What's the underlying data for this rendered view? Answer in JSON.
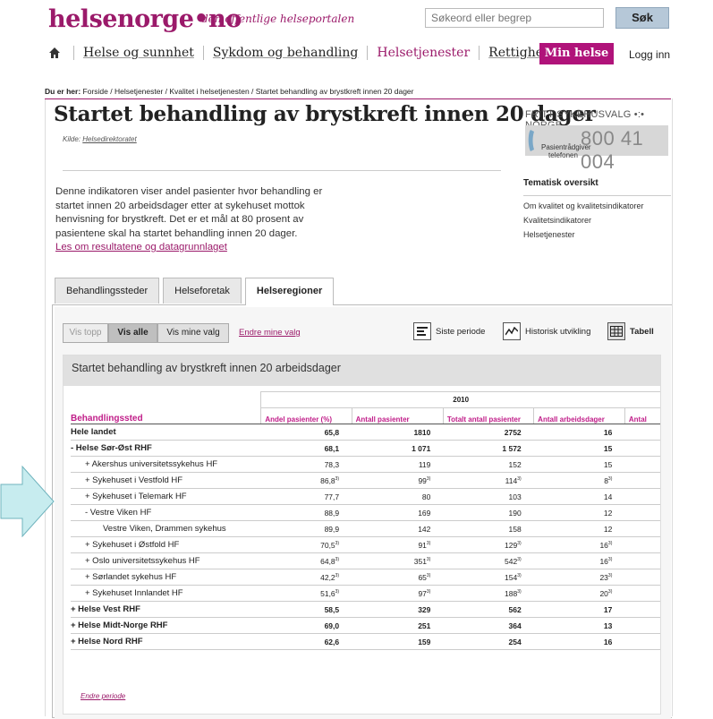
{
  "header": {
    "logo_text": "helsenorge",
    "logo_dot": "•",
    "logo_suffix": "no",
    "tagline": "den offentlige helseportalen",
    "search_placeholder": "Søkeord eller begrep",
    "search_button": "Søk"
  },
  "nav": {
    "items": [
      {
        "label": "Helse og sunnhet"
      },
      {
        "label": "Sykdom og behandling"
      },
      {
        "label": "Helsetjenester"
      },
      {
        "label": "Rettigheter"
      }
    ],
    "min_helse": "Min helse",
    "login": "Logg inn"
  },
  "breadcrumb": {
    "prefix": "Du er her:",
    "path": "Forside / Helsetjenester / Kvalitet i helsetjenesten / Startet behandling av brystkreft innen 20 dager"
  },
  "page": {
    "title": "Startet behandling av brystkreft innen 20 dager",
    "source_label": "Kilde:",
    "source_link": "Helsedirektoratet",
    "intro": "Denne indikatoren viser andel pasienter hvor behandling er startet innen 20 arbeidsdager etter at sykehuset mottok henvisning for brystkreft. Det er et mål at 80 prosent av pasientene skal ha startet behandling innen 20 dager.",
    "intro_link": "Les om resultatene og datagrunnlaget"
  },
  "fritt": {
    "title": "FRITT SYKEHUSVALG •:• NORGE",
    "phone_label_1": "Pasientrådgiver",
    "phone_label_2": "telefonen",
    "phone_number": "800 41 004"
  },
  "thematic": {
    "heading": "Tematisk oversikt",
    "links": [
      "Om kvalitet og kvalitetsindikatorer",
      "Kvalitetsindikatorer",
      "Helsetjenester"
    ]
  },
  "tabs": [
    {
      "label": "Behandlingssteder"
    },
    {
      "label": "Helseforetak"
    },
    {
      "label": "Helseregioner"
    }
  ],
  "controls": {
    "vis_topp": "Vis topp",
    "vis_alle": "Vis alle",
    "vis_mine": "Vis mine valg",
    "endre_mine": "Endre mine valg",
    "siste_periode": "Siste periode",
    "historisk": "Historisk utvikling",
    "tabell": "Tabell"
  },
  "table": {
    "heading": "Startet behandling av brystkreft innen 20 arbeidsdager",
    "year": "2010",
    "columns": [
      "Behandlingssted",
      "Andel pasienter (%)",
      "Antall pasienter",
      "Totalt antall pasienter",
      "Antall arbeidsdager",
      "Antal"
    ],
    "rows": [
      {
        "name": "Hele landet",
        "andel": "65,8",
        "antall": "1810",
        "totalt": "2752",
        "dager": "16",
        "sup": false,
        "bold": true
      },
      {
        "name": "- Helse Sør-Øst RHF",
        "andel": "68,1",
        "antall": "1 071",
        "totalt": "1 572",
        "dager": "15",
        "sup": false,
        "bold": true
      },
      {
        "name": "+ Akershus universitetssykehus HF",
        "andel": "78,3",
        "antall": "119",
        "totalt": "152",
        "dager": "15",
        "sup": false,
        "bold": false
      },
      {
        "name": "+ Sykehuset i Vestfold HF",
        "andel": "86,8",
        "antall": "99",
        "totalt": "114",
        "dager": "8",
        "sup": true,
        "bold": false
      },
      {
        "name": "+ Sykehuset i Telemark HF",
        "andel": "77,7",
        "antall": "80",
        "totalt": "103",
        "dager": "14",
        "sup": false,
        "bold": false
      },
      {
        "name": "- Vestre Viken HF",
        "andel": "88,9",
        "antall": "169",
        "totalt": "190",
        "dager": "12",
        "sup": false,
        "bold": false
      },
      {
        "name": "Vestre Viken, Drammen sykehus",
        "andel": "89,9",
        "antall": "142",
        "totalt": "158",
        "dager": "12",
        "sup": false,
        "bold": false
      },
      {
        "name": "+ Sykehuset i Østfold HF",
        "andel": "70,5",
        "antall": "91",
        "totalt": "129",
        "dager": "16",
        "sup": true,
        "bold": false
      },
      {
        "name": "+ Oslo universitetssykehus HF",
        "andel": "64,8",
        "antall": "351",
        "totalt": "542",
        "dager": "16",
        "sup": true,
        "bold": false
      },
      {
        "name": "+ Sørlandet sykehus HF",
        "andel": "42,2",
        "antall": "65",
        "totalt": "154",
        "dager": "23",
        "sup": true,
        "bold": false
      },
      {
        "name": "+ Sykehuset Innlandet HF",
        "andel": "51,6",
        "antall": "97",
        "totalt": "188",
        "dager": "20",
        "sup": true,
        "bold": false
      },
      {
        "name": "+ Helse Vest RHF",
        "andel": "58,5",
        "antall": "329",
        "totalt": "562",
        "dager": "17",
        "sup": false,
        "bold": true
      },
      {
        "name": "+ Helse Midt-Norge RHF",
        "andel": "69,0",
        "antall": "251",
        "totalt": "364",
        "dager": "13",
        "sup": false,
        "bold": true
      },
      {
        "name": "+ Helse Nord RHF",
        "andel": "62,6",
        "antall": "159",
        "totalt": "254",
        "dager": "16",
        "sup": false,
        "bold": true
      }
    ],
    "sup_mark": "3)",
    "endre_periode": "Endre periode"
  },
  "colors": {
    "brand": "#9b1a6a",
    "min_helse_bg": "#b0137a",
    "arrow": "#c7ecef"
  }
}
